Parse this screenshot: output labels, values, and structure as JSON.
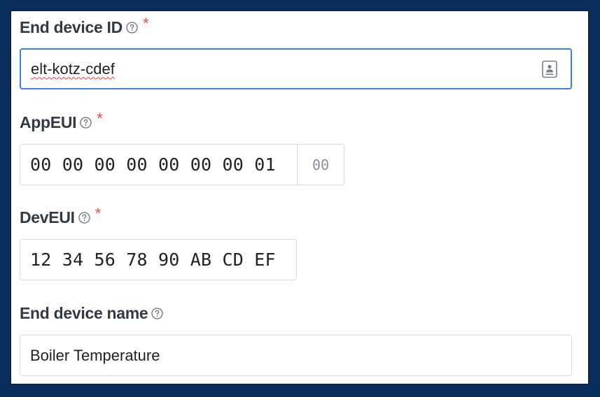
{
  "fields": {
    "device_id": {
      "label": "End device ID",
      "required_marker": "*",
      "value": "elt-kotz-cdef"
    },
    "app_eui": {
      "label": "AppEUI",
      "required_marker": "*",
      "value": "00 00 00 00 00 00 00 01",
      "next_byte_placeholder": "00"
    },
    "dev_eui": {
      "label": "DevEUI",
      "required_marker": "*",
      "value": "12 34 56 78 90 AB CD EF"
    },
    "device_name": {
      "label": "End device name",
      "value": "Boiler Temperature"
    }
  },
  "icons": {
    "help": "help-circle-icon",
    "autofill": "contact-card-icon"
  },
  "colors": {
    "frame": "#0b2d5c",
    "focus_border": "#3f7fe0",
    "required": "#e0504a",
    "label_text": "#333a44"
  }
}
